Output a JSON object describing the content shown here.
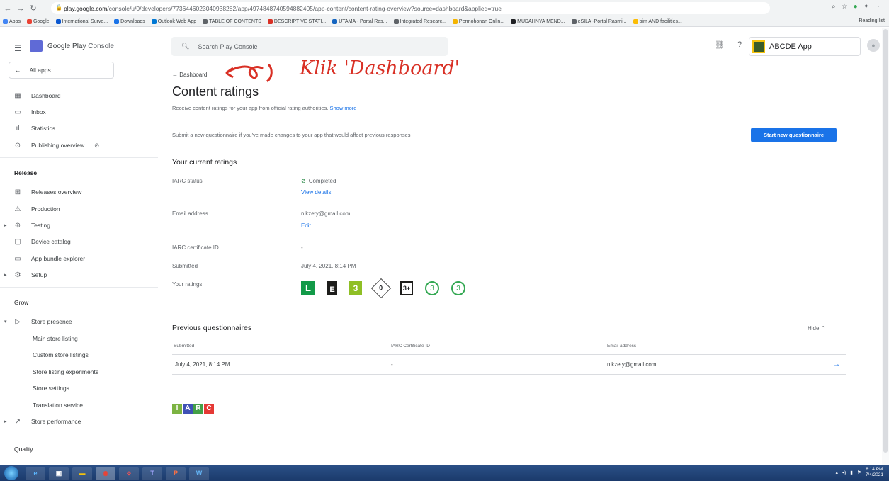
{
  "browser": {
    "url_host": "play.google.com",
    "url_path": "/console/u/0/developers/7736446023040938282/app/4974848740594882405/app-content/content-rating-overview?source=dashboard&applied=true",
    "bookmarks": [
      "Apps",
      "Google",
      "International Surve...",
      "Downloads",
      "Outlook Web App",
      "TABLE OF CONTENTS",
      "DESCRIPTIVE STATI...",
      "UTAMA - Portal Ras...",
      "Integrated Researc...",
      "Permohonan Onlin...",
      "MUDAHNYA MEND...",
      "eSILA -Portal Rasmi...",
      "bim AND facilities..."
    ],
    "reading_list": "Reading list"
  },
  "sidebar": {
    "logo_brand": "Google Play",
    "logo_console": "Console",
    "all_apps": "All apps",
    "items_top": [
      "Dashboard",
      "Inbox",
      "Statistics",
      "Publishing overview"
    ],
    "release_heading": "Release",
    "release_items": [
      "Releases overview",
      "Production",
      "Testing",
      "Device catalog",
      "App bundle explorer",
      "Setup"
    ],
    "grow_heading": "Grow",
    "store_presence": "Store presence",
    "store_sub": [
      "Main store listing",
      "Custom store listings",
      "Store listing experiments",
      "Store settings",
      "Translation service"
    ],
    "store_performance": "Store performance",
    "quality_heading": "Quality"
  },
  "topbar": {
    "search_placeholder": "Search Play Console",
    "app_name": "ABCDE App"
  },
  "main": {
    "back_label": "← Dashboard",
    "annotation": "Klik 'Dashboard'",
    "title": "Content ratings",
    "description": "Receive content ratings for your app from official rating authorities.",
    "show_more": "Show more",
    "submit_text": "Submit a new questionnaire if you've made changes to your app that would affect previous responses",
    "start_button": "Start new questionnaire",
    "current_title": "Your current ratings",
    "iarc_status_label": "IARC status",
    "iarc_status_value": "Completed",
    "view_details": "View details",
    "email_label": "Email address",
    "email_value": "nikzety@gmail.com",
    "edit": "Edit",
    "cert_label": "IARC certificate ID",
    "cert_value": "-",
    "submitted_label": "Submitted",
    "submitted_value": "July 4, 2021, 8:14 PM",
    "your_ratings_label": "Your ratings",
    "ratings": [
      "L",
      "E",
      "3",
      "0",
      "3+",
      "3",
      "3"
    ],
    "previous_title": "Previous questionnaires",
    "hide": "Hide",
    "table_headers": [
      "Submitted",
      "IARC Certificate ID",
      "Email address"
    ],
    "table_row": [
      "July 4, 2021, 8:14 PM",
      "-",
      "nikzety@gmail.com"
    ],
    "iarc_logo": [
      "I",
      "A",
      "R",
      "C"
    ],
    "iarc_colors": [
      "#7cb342",
      "#3f51b5",
      "#43a047",
      "#e53935"
    ]
  },
  "taskbar": {
    "time": "8:14 PM",
    "date": "7/4/2021"
  },
  "colors": {
    "accent": "#1a73e8",
    "annotation": "#d93025",
    "success": "#188038"
  }
}
